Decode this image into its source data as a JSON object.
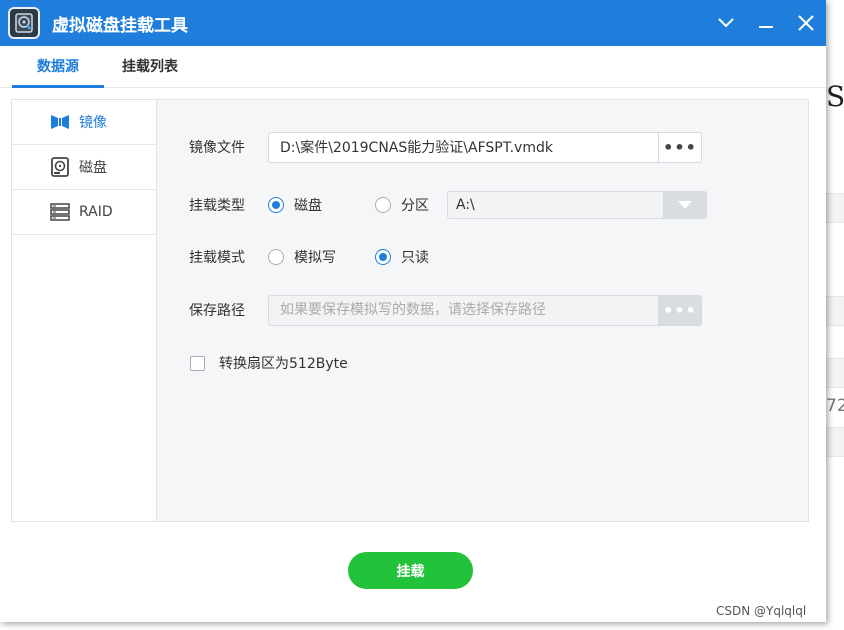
{
  "window": {
    "title": "虚拟磁盘挂载工具",
    "controls": [
      "chevron-down-icon",
      "minimize-icon",
      "close-icon"
    ]
  },
  "tabs": [
    {
      "label": "数据源",
      "active": true
    },
    {
      "label": "挂载列表",
      "active": false
    }
  ],
  "sidebar": {
    "items": [
      {
        "label": "镜像",
        "icon": "image-file-icon",
        "active": true
      },
      {
        "label": "磁盘",
        "icon": "disk-icon",
        "active": false
      },
      {
        "label": "RAID",
        "icon": "raid-icon",
        "active": false
      }
    ]
  },
  "form": {
    "image_file": {
      "label": "镜像文件",
      "value": "D:\\案件\\2019CNAS能力验证\\AFSPT.vmdk",
      "browse": "•••"
    },
    "mount_type": {
      "label": "挂载类型",
      "options": [
        {
          "label": "磁盘",
          "checked": true
        },
        {
          "label": "分区",
          "checked": false
        }
      ],
      "partition_select": {
        "value": "A:\\"
      }
    },
    "mount_mode": {
      "label": "挂载模式",
      "options": [
        {
          "label": "模拟写",
          "checked": false
        },
        {
          "label": "只读",
          "checked": true
        }
      ]
    },
    "save_path": {
      "label": "保存路径",
      "placeholder": "如果要保存模拟写的数据，请选择保存路径",
      "browse": "•••"
    },
    "convert_sector": {
      "label": "转换扇区为512Byte",
      "checked": false
    }
  },
  "actions": {
    "mount_label": "挂载"
  },
  "background": {
    "fragment_text": "SI",
    "fragment_number": "72"
  },
  "watermark": "CSDN @Yqlqlql",
  "colors": {
    "accent": "#1f7edc",
    "mount_button": "#22c23b"
  }
}
